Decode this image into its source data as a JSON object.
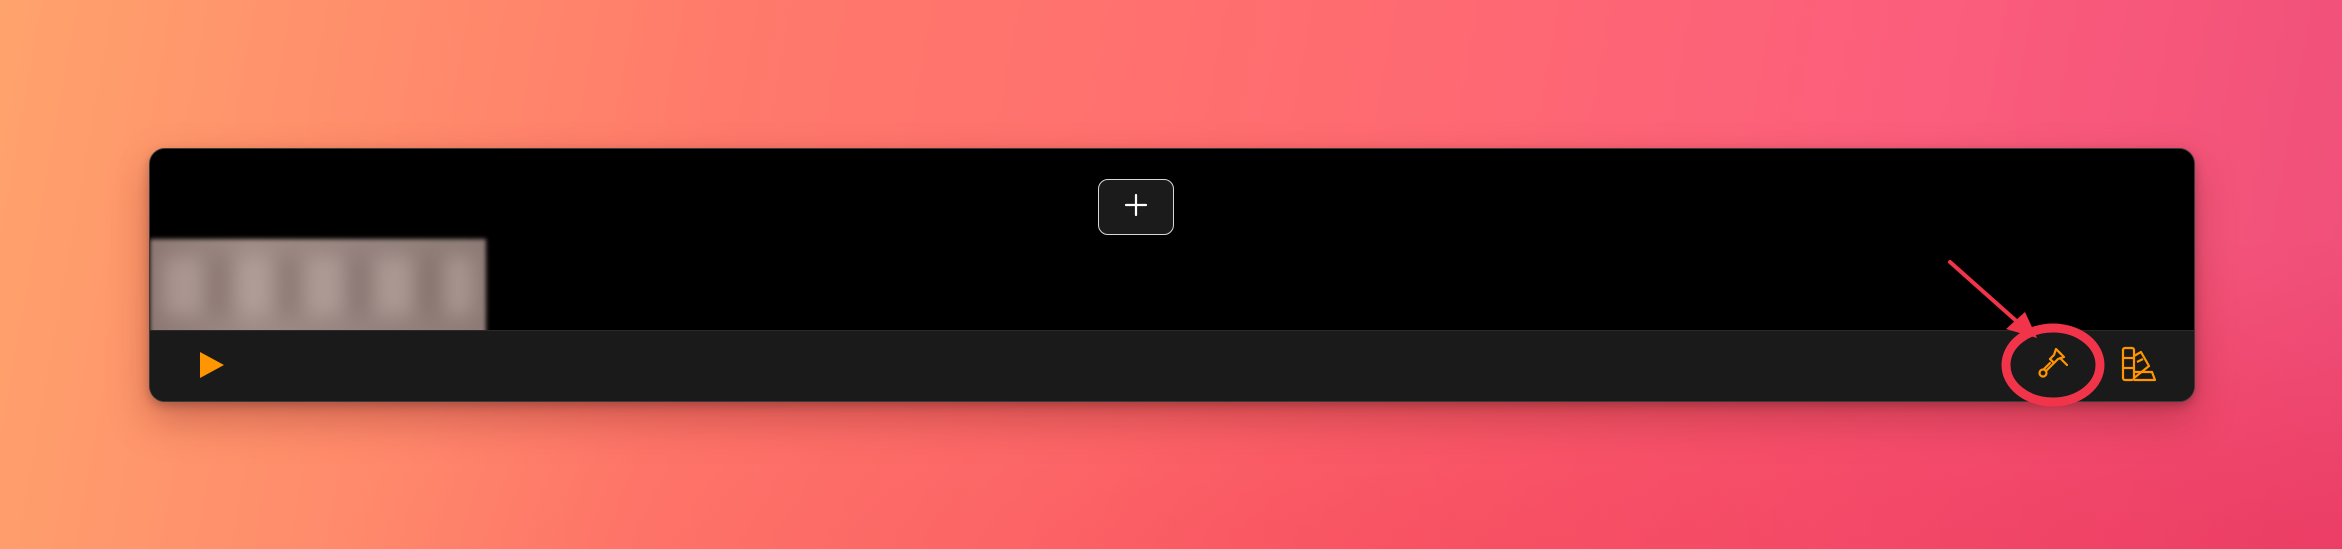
{
  "canvas": {
    "add_button": {
      "icon": "plus-icon"
    },
    "thumbnail": {
      "state": "blurred"
    }
  },
  "toolbar": {
    "play": {
      "icon": "play-icon"
    },
    "brush": {
      "icon": "paintbrush-icon",
      "highlighted": true
    },
    "palette": {
      "icon": "color-swatch-icon"
    }
  },
  "colors": {
    "accent": "#ff9500",
    "annotation": "#f2344a",
    "window_bg": "#000000",
    "toolbar_bg": "#1a1a1a"
  }
}
